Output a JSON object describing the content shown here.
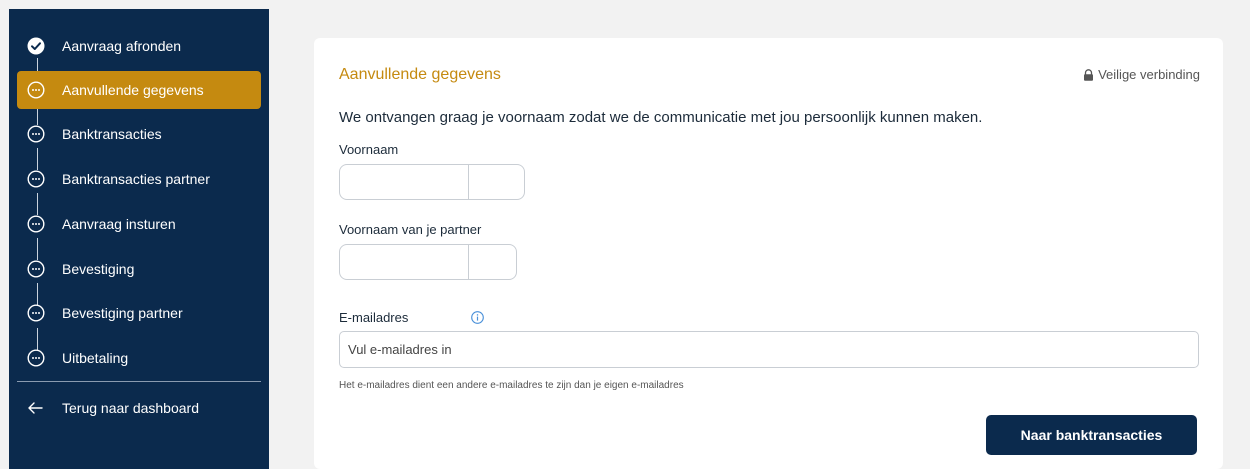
{
  "sidebar": {
    "steps": [
      {
        "label": "Aanvraag afronden",
        "status": "done"
      },
      {
        "label": "Aanvullende gegevens",
        "status": "active"
      },
      {
        "label": "Banktransacties",
        "status": "pending"
      },
      {
        "label": "Banktransacties partner",
        "status": "pending"
      },
      {
        "label": "Aanvraag insturen",
        "status": "pending"
      },
      {
        "label": "Bevestiging",
        "status": "pending"
      },
      {
        "label": "Bevestiging partner",
        "status": "pending"
      },
      {
        "label": "Uitbetaling",
        "status": "pending"
      }
    ],
    "back_label": "Terug naar dashboard"
  },
  "main": {
    "title": "Aanvullende gegevens",
    "secure_label": "Veilige verbinding",
    "intro": "We ontvangen graag je voornaam zodat we de communicatie met jou persoonlijk kunnen maken.",
    "first_name_label": "Voornaam",
    "first_name_value": "",
    "partner_name_label": "Voornaam van je partner",
    "partner_name_value": "",
    "email_label": "E-mailadres",
    "email_placeholder": "Vul e-mailadres in",
    "email_hint": "Het e-mailadres dient een andere e-mailadres te zijn dan je eigen e-mailadres",
    "submit_label": "Naar banktransacties"
  },
  "colors": {
    "sidebar_bg": "#0b2a4d",
    "accent": "#c58a10",
    "info": "#4a90d9"
  }
}
